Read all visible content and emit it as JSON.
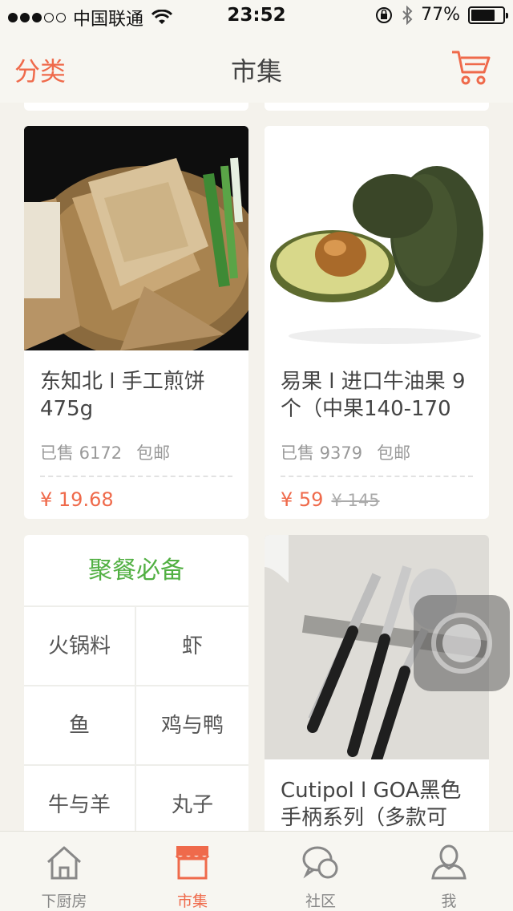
{
  "status_bar": {
    "carrier": "中国联通",
    "time": "23:52",
    "battery": "77%",
    "battery_level": 0.77
  },
  "nav": {
    "left_label": "分类",
    "title": "市集",
    "right_icon": "cart-icon"
  },
  "products": [
    {
      "title": "东知北 l 手工煎饼 475g",
      "sold": "已售 6172",
      "shipping": "包邮",
      "price": "¥ 19.68",
      "old_price": ""
    },
    {
      "title": "易果 l 进口牛油果 9个（中果140-170",
      "sold": "已售 9379",
      "shipping": "包邮",
      "price": "¥ 59",
      "old_price": "¥ 145"
    },
    {
      "title": "Cutipol l GOA黑色手柄系列（多款可"
    }
  ],
  "category_card": {
    "title": "聚餐必备",
    "items": [
      "火锅料",
      "虾",
      "鱼",
      "鸡与鸭",
      "牛与羊",
      "丸子"
    ]
  },
  "tabs": [
    {
      "label": "下厨房",
      "icon": "home-icon"
    },
    {
      "label": "市集",
      "icon": "store-icon"
    },
    {
      "label": "社区",
      "icon": "chat-icon"
    },
    {
      "label": "我",
      "icon": "user-icon"
    }
  ],
  "colors": {
    "accent": "#ef6a4b",
    "green": "#52b043",
    "background": "#f4f2ec"
  }
}
